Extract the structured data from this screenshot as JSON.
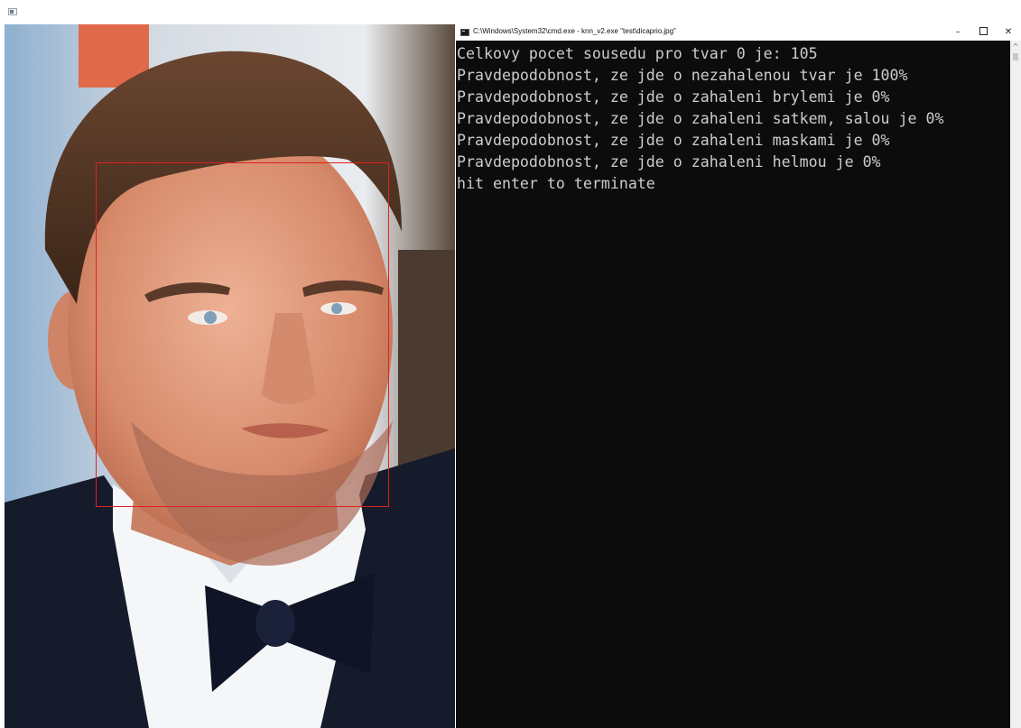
{
  "host": {
    "icon": "image-viewer-icon"
  },
  "photo": {
    "icon": "portrait-photo",
    "detection_color": "#e02020"
  },
  "console": {
    "title": "C:\\Windows\\System32\\cmd.exe - knn_v2.exe  \"test\\dicaprio.jpg\"",
    "controls": {
      "minimize": "–",
      "maximize": "☐",
      "close": "✕"
    },
    "lines": [
      "Celkovy pocet sousedu pro tvar 0 je: 105",
      "Pravdepodobnost, ze jde o nezahalenou tvar je 100%",
      "Pravdepodobnost, ze jde o zahaleni brylemi je 0%",
      "Pravdepodobnost, ze jde o zahaleni satkem, salou je 0%",
      "Pravdepodobnost, ze jde o zahaleni maskami je 0%",
      "Pravdepodobnost, ze jde o zahaleni helmou je 0%",
      "hit enter to terminate"
    ],
    "background": "#0c0c0c",
    "text_color": "#cccccc",
    "scroll_up": "^"
  }
}
